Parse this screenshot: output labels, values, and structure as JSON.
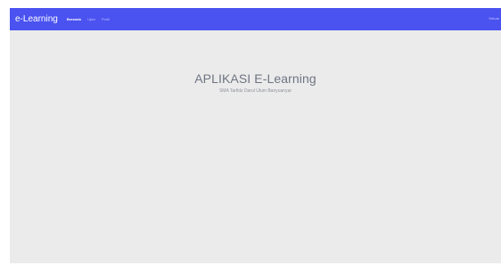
{
  "navbar": {
    "brand": "e-Learning",
    "links": [
      {
        "label": "Beranda",
        "active": true
      },
      {
        "label": "Ujian",
        "active": false
      },
      {
        "label": "Profil",
        "active": false
      }
    ],
    "right_label": "Keluar",
    "bg_color": "#4a52f0"
  },
  "hero": {
    "title": "APLIKASI E-Learning",
    "subtitle": "SMA Tarfidz Darul Ulum Banyuanyar"
  }
}
